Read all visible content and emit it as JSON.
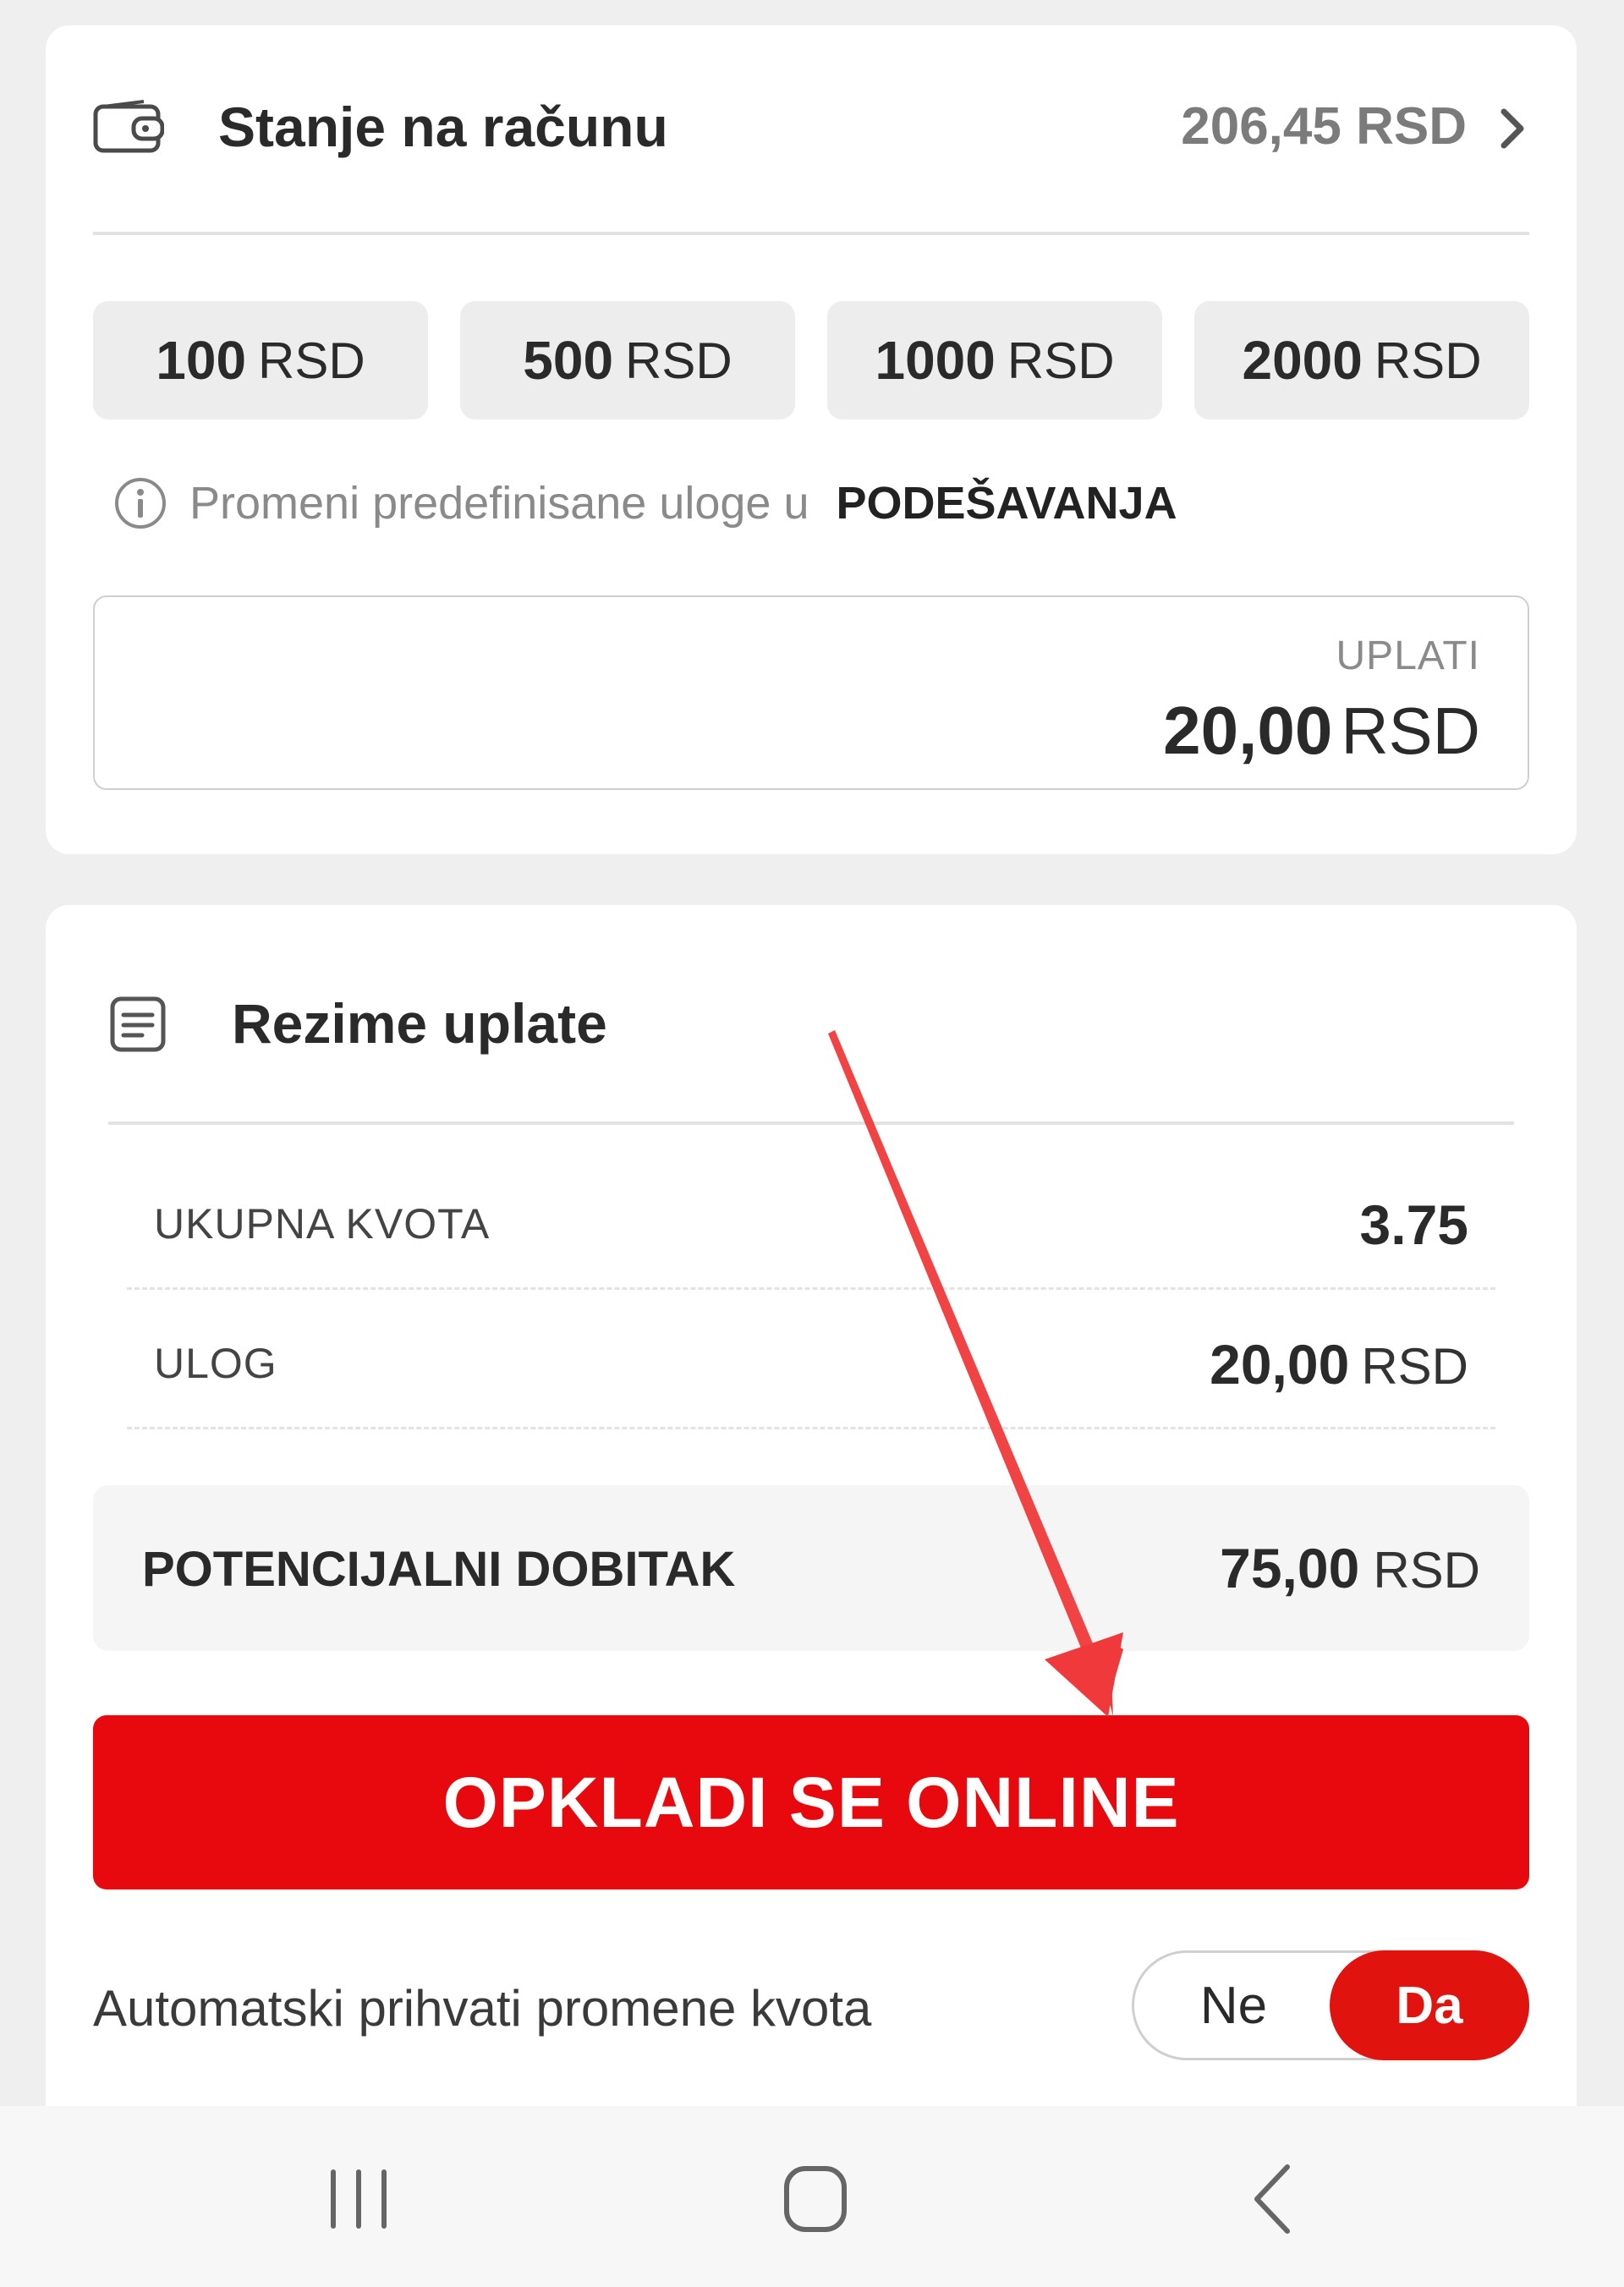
{
  "balance": {
    "title": "Stanje na računu",
    "amount": "206,45 RSD"
  },
  "quick_stakes": [
    {
      "amount": "100",
      "currency": "RSD"
    },
    {
      "amount": "500",
      "currency": "RSD"
    },
    {
      "amount": "1000",
      "currency": "RSD"
    },
    {
      "amount": "2000",
      "currency": "RSD"
    }
  ],
  "info": {
    "text": "Promeni predefinisane uloge u",
    "link": "PODEŠAVANJA"
  },
  "stake_input": {
    "label": "UPLATI",
    "value": "20,00",
    "currency": "RSD"
  },
  "summary": {
    "title": "Rezime uplate",
    "rows": [
      {
        "label": "UKUPNA KVOTA",
        "value": "3.75",
        "currency": ""
      },
      {
        "label": "ULOG",
        "value": "20,00",
        "currency": "RSD"
      }
    ],
    "potential_win": {
      "label": "POTENCIJALNI DOBITAK",
      "value": "75,00",
      "currency": "RSD"
    }
  },
  "bet_button": {
    "label": "OPKLADI SE ONLINE"
  },
  "auto_accept": {
    "label": "Automatski prihvati promene kvota",
    "options": [
      "Ne",
      "Da"
    ],
    "selected": "Da"
  },
  "colors": {
    "accent": "#e8090e",
    "background": "#efefef",
    "card": "#ffffff",
    "annotation_arrow": "#f0393a"
  },
  "icons": {
    "balance": "wallet-icon",
    "info": "info-icon",
    "summary": "receipt-icon",
    "balance_chevron": "chevron-right-icon",
    "nav": [
      "recent-apps-icon",
      "home-icon",
      "back-icon"
    ]
  }
}
